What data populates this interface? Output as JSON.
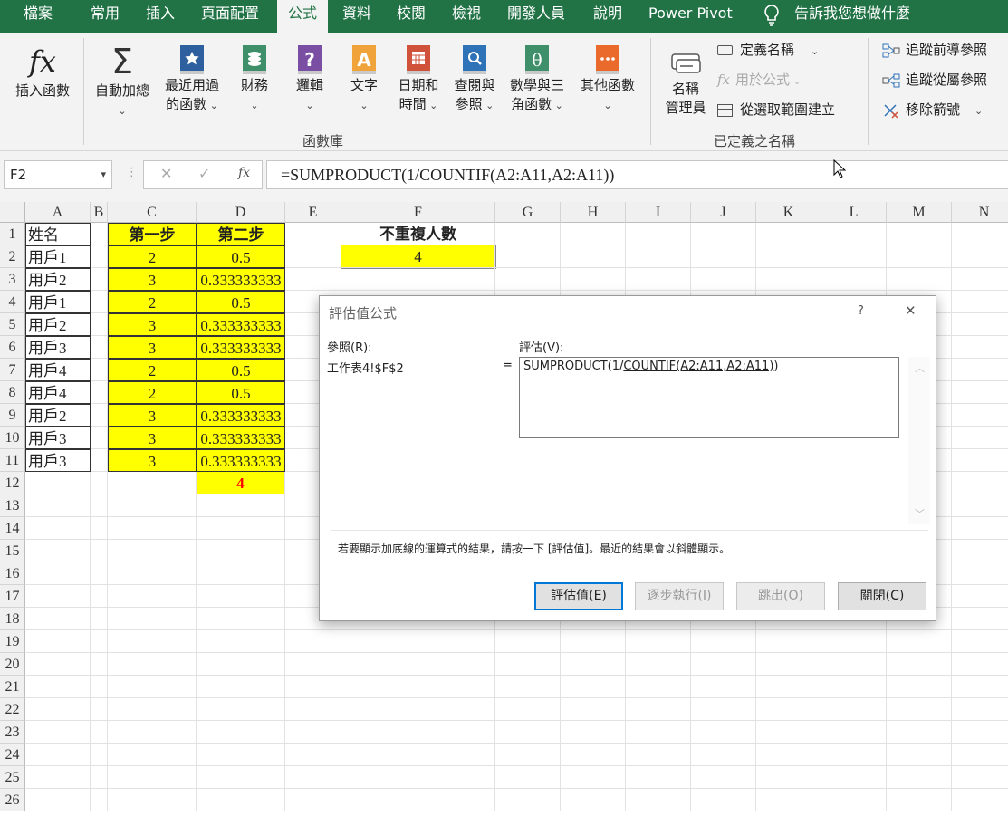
{
  "tabs": [
    "檔案",
    "常用",
    "插入",
    "頁面配置",
    "公式",
    "資料",
    "校閱",
    "檢視",
    "開發人員",
    "說明",
    "Power Pivot"
  ],
  "tell_me": "告訴我您想做什麼",
  "ribbon": {
    "insert_function": "插入函數",
    "autosum": [
      "自動加總",
      ""
    ],
    "recent": [
      "最近用過",
      "的函數"
    ],
    "financial": [
      "財務",
      ""
    ],
    "logical": [
      "邏輯",
      ""
    ],
    "text": [
      "文字",
      ""
    ],
    "datetime": [
      "日期和",
      "時間"
    ],
    "lookup": [
      "查閱與",
      "參照"
    ],
    "math": [
      "數學與三",
      "角函數"
    ],
    "more": [
      "其他函數",
      ""
    ],
    "group_library": "函數庫",
    "name_manager": [
      "名稱",
      "管理員"
    ],
    "define_name": "定義名稱",
    "use_in_formula": "用於公式",
    "create_from_selection": "從選取範圍建立",
    "group_names": "已定義之名稱",
    "trace_precedents": "追蹤前導參照",
    "trace_dependents": "追蹤從屬參照",
    "remove_arrows": "移除箭號"
  },
  "formula_bar": {
    "name_box": "F2",
    "formula": "=SUMPRODUCT(1/COUNTIF(A2:A11,A2:A11))"
  },
  "columns": [
    "A",
    "B",
    "C",
    "D",
    "E",
    "F",
    "G",
    "H",
    "I",
    "J",
    "K",
    "L",
    "M",
    "N"
  ],
  "rows": [
    "1",
    "2",
    "3",
    "4",
    "5",
    "6",
    "7",
    "8",
    "9",
    "10",
    "11",
    "12",
    "13",
    "14",
    "15",
    "16",
    "17",
    "18",
    "19",
    "20",
    "21",
    "22",
    "23",
    "24",
    "25",
    "26"
  ],
  "cells": {
    "A": [
      "姓名",
      "用戶1",
      "用戶2",
      "用戶1",
      "用戶2",
      "用戶3",
      "用戶4",
      "用戶4",
      "用戶2",
      "用戶3",
      "用戶3"
    ],
    "C": [
      "第一步",
      "2",
      "3",
      "2",
      "3",
      "3",
      "2",
      "2",
      "3",
      "3",
      "3"
    ],
    "D": [
      "第二步",
      "0.5",
      "0.333333333",
      "0.5",
      "0.333333333",
      "0.333333333",
      "0.5",
      "0.5",
      "0.333333333",
      "0.333333333",
      "0.333333333",
      "4"
    ],
    "F1": "不重複人數",
    "F2": "4"
  },
  "dialog": {
    "title": "評估值公式",
    "help": "?",
    "close": "✕",
    "ref_label": "參照(R):",
    "ref_value": "工作表4!$F$2",
    "eq": "=",
    "eval_label": "評估(V):",
    "expr_pre": "SUMPRODUCT(1/",
    "expr_ul": "COUNTIF(A2:A11,A2:A11)",
    "expr_post": ")",
    "hint": "若要顯示加底線的運算式的結果，請按一下 [評估值]。最近的結果會以斜體顯示。",
    "buttons": [
      "評估值(E)",
      "逐步執行(I)",
      "跳出(O)",
      "關閉(C)"
    ]
  }
}
